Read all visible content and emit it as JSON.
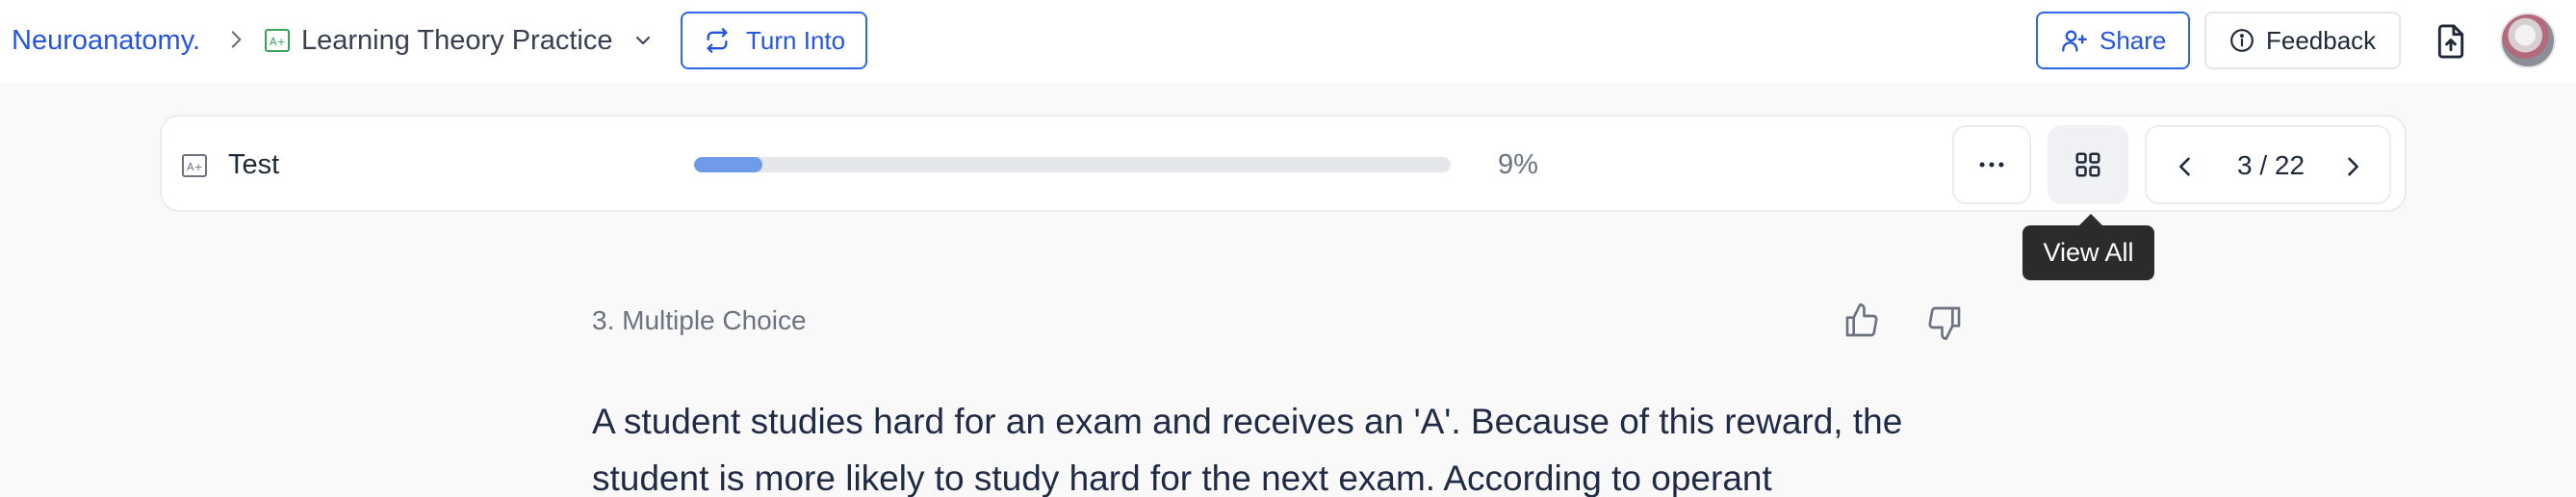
{
  "breadcrumb": {
    "root": "Neuroanatomy.",
    "title": "Learning Theory Practice"
  },
  "toolbar": {
    "turn_into": "Turn Into",
    "share": "Share",
    "feedback": "Feedback"
  },
  "test": {
    "label": "Test",
    "progress_fraction": 0.09,
    "progress_text": "9%",
    "pager_text": "3 / 22"
  },
  "tooltip": {
    "text": "View All"
  },
  "question": {
    "number_label": "3. Multiple Choice",
    "text": "A student studies hard for an exam and receives an 'A'. Because of this reward, the student is more likely to study hard for the next exam. According to operant"
  },
  "colors": {
    "accent": "#2555e0",
    "progress": "#6f9be9",
    "doc_icon": "#3aa35c"
  }
}
